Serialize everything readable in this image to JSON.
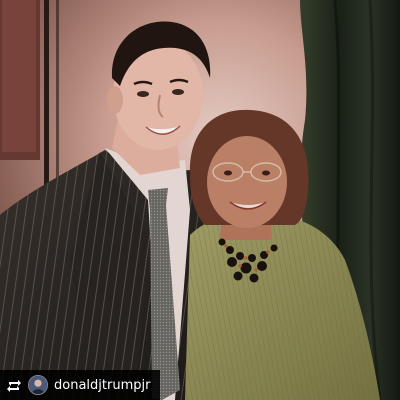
{
  "overlay": {
    "repost_icon": "repost-icon",
    "username": "donaldjtrumpjr"
  },
  "colors": {
    "overlay_bg": "#000000",
    "overlay_text": "#ffffff",
    "background_wall": "#c8978a",
    "curtain": "#1f2a1c",
    "suit": "#2a2623",
    "sweater": "#8f8c55"
  }
}
